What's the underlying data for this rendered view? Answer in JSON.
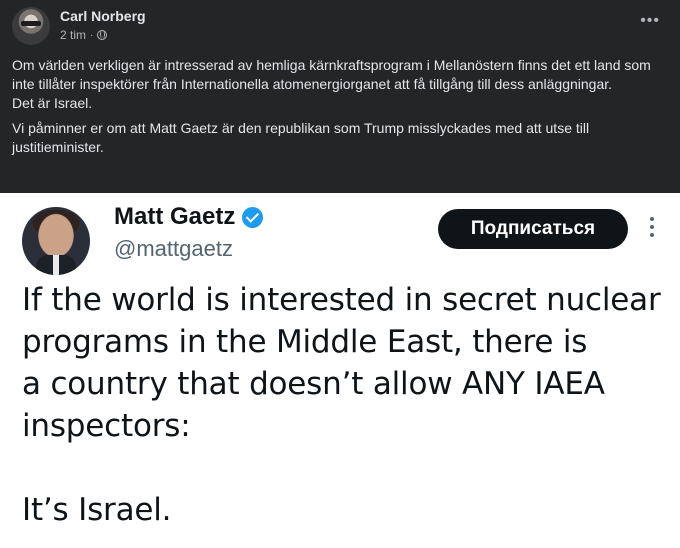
{
  "fb_post": {
    "author_name": "Carl Norberg",
    "timestamp": "2 tim",
    "separator": "·",
    "privacy_icon": "globe-icon",
    "more_icon": "more-horizontal-icon",
    "more_label": "•••",
    "paragraphs": [
      "Om världen verkligen är intresserad av hemliga kärnkraftsprogram i Mellanöstern finns det ett land som inte tillåter inspektörer från Internationella atomenergiorganet att få tillgång till dess anläggningar.",
      "Det är Israel.",
      "Vi påminner er om att Matt Gaetz är den republikan som Trump misslyckades med att utse till justitieminister."
    ]
  },
  "tweet": {
    "display_name": "Matt Gaetz",
    "handle": "@mattgaetz",
    "verified_icon": "verified-badge-icon",
    "follow_label": "Подписаться",
    "more_icon": "more-vertical-icon",
    "text_lines": [
      "If the world is interested in secret nuclear",
      "programs in the Middle East, there is",
      "a country that doesn’t allow ANY IAEA",
      "inspectors:",
      "It’s Israel."
    ]
  },
  "colors": {
    "fb_background": "#242526",
    "fb_text": "#e4e6eb",
    "fb_secondary": "#b0b3b8",
    "tweet_verified": "#1d9bf0",
    "tweet_button": "#0f1419"
  }
}
